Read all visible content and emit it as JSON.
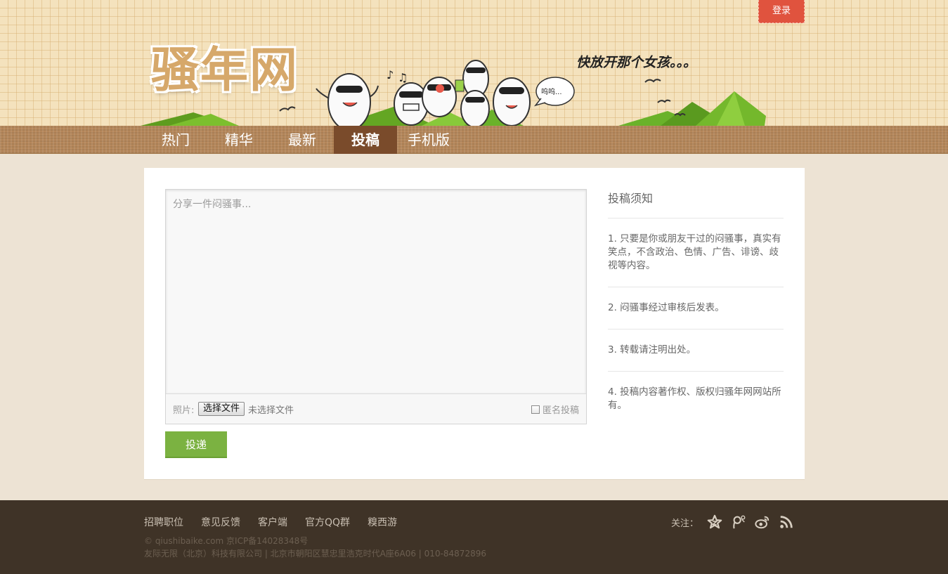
{
  "header": {
    "login_label": "登录",
    "logo_text": "骚年网",
    "slogan": "快放开那个女孩。。。",
    "bubble_text": "呜呜..."
  },
  "nav": {
    "items": [
      {
        "label": "热门"
      },
      {
        "label": "精华"
      },
      {
        "label": "最新"
      },
      {
        "label": "投稿",
        "active": true
      },
      {
        "label": "手机版"
      }
    ]
  },
  "editor": {
    "placeholder": "分享一件闷骚事...",
    "photo_label": "照片:",
    "file_button": "选择文件",
    "file_status": "未选择文件",
    "anonymous_label": "匿名投稿",
    "anonymous_checked": false,
    "submit_label": "投递"
  },
  "guide": {
    "title": "投稿须知",
    "items": [
      "1. 只要是你或朋友干过的闷骚事，真实有笑点，不含政治、色情、广告、诽谤、歧视等内容。",
      "2. 闷骚事经过审核后发表。",
      "3. 转载请注明出处。",
      "4. 投稿内容著作权、版权归骚年网网站所有。"
    ]
  },
  "footer": {
    "links": [
      "招聘职位",
      "意见反馈",
      "客户端",
      "官方QQ群",
      "糗西游"
    ],
    "copyright": "© qiushibaike.com 京ICP备14028348号",
    "company": "友际无限（北京）科技有限公司 | 北京市朝阳区慧忠里浩克时代A座6A06 | 010-84872896",
    "follow_label": "关注：",
    "social_icons": [
      "qzone-star-icon",
      "tencent-weibo-icon",
      "sina-weibo-icon",
      "rss-icon"
    ]
  },
  "colors": {
    "login": "#e0533e",
    "nav": "#b5875a",
    "nav_active": "#7a4b2b",
    "submit": "#7bb241",
    "footer": "#3f3327",
    "page_bg": "#ede3d4"
  }
}
